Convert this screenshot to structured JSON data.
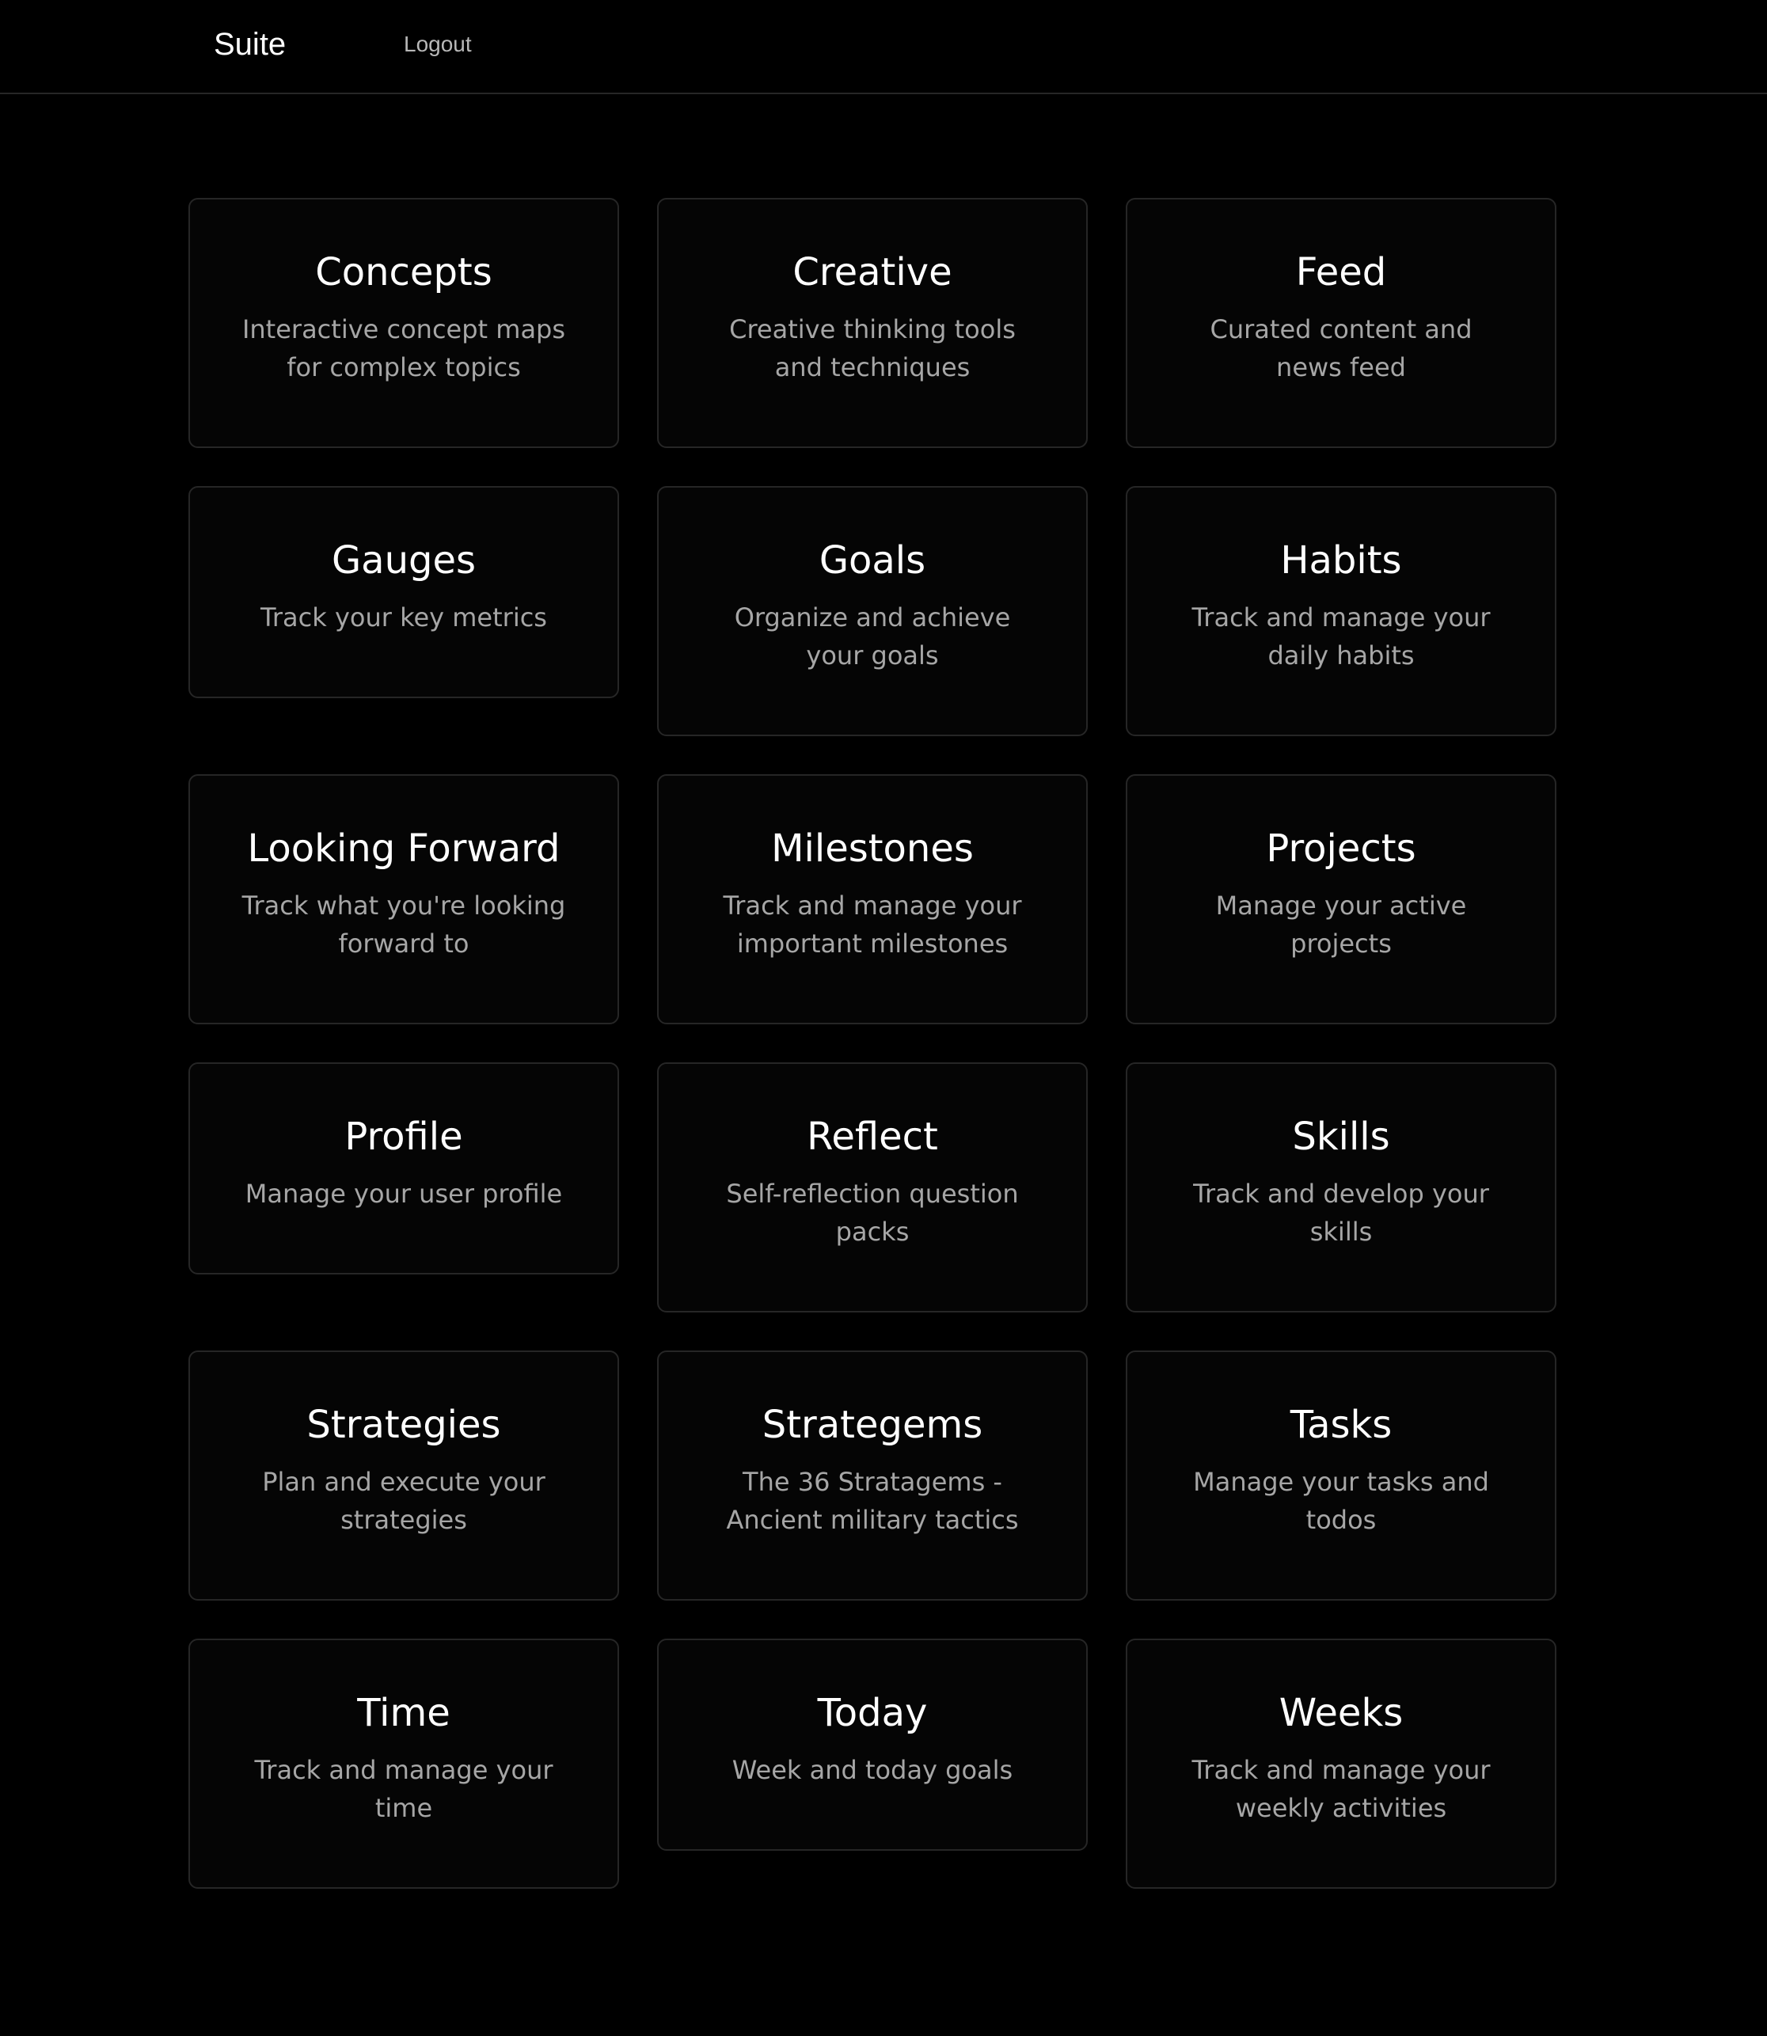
{
  "header": {
    "brand": "Suite",
    "logout_label": "Logout"
  },
  "cards": [
    {
      "title": "Concepts",
      "description": "Interactive concept maps for complex topics"
    },
    {
      "title": "Creative",
      "description": "Creative thinking tools and techniques"
    },
    {
      "title": "Feed",
      "description": "Curated content and news feed"
    },
    {
      "title": "Gauges",
      "description": "Track your key metrics"
    },
    {
      "title": "Goals",
      "description": "Organize and achieve your goals"
    },
    {
      "title": "Habits",
      "description": "Track and manage your daily habits"
    },
    {
      "title": "Looking Forward",
      "description": "Track what you're looking forward to"
    },
    {
      "title": "Milestones",
      "description": "Track and manage your important milestones"
    },
    {
      "title": "Projects",
      "description": "Manage your active projects"
    },
    {
      "title": "Profile",
      "description": "Manage your user profile"
    },
    {
      "title": "Reflect",
      "description": "Self-reflection question packs"
    },
    {
      "title": "Skills",
      "description": "Track and develop your skills"
    },
    {
      "title": "Strategies",
      "description": "Plan and execute your strategies"
    },
    {
      "title": "Strategems",
      "description": "The 36 Stratagems - Ancient military tactics"
    },
    {
      "title": "Tasks",
      "description": "Manage your tasks and todos"
    },
    {
      "title": "Time",
      "description": "Track and manage your time"
    },
    {
      "title": "Today",
      "description": "Week and today goals"
    },
    {
      "title": "Weeks",
      "description": "Track and manage your weekly activities"
    }
  ]
}
